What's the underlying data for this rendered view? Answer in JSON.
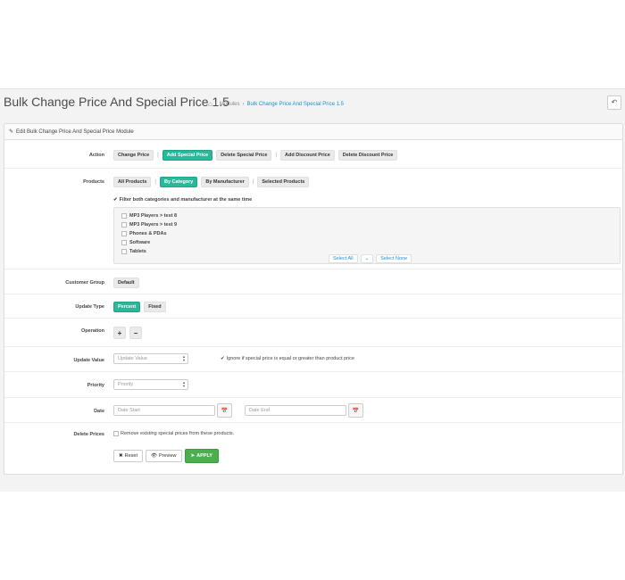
{
  "header": {
    "title": "Bulk Change Price And Special Price 1.5",
    "breadcrumb": [
      "Modules",
      "Bulk Change Price And Special Price 1.5"
    ],
    "home_icon": "home-icon",
    "back_icon": "reply-icon"
  },
  "panel": {
    "heading": "Edit Bulk Change Price And Special Price Module",
    "heading_icon": "pencil-icon"
  },
  "form": {
    "action": {
      "label": "Action",
      "options": [
        "Change Price",
        "Add Special Price",
        "Delete Special Price",
        "Add Discount Price",
        "Delete Discount Price"
      ],
      "selected": "Add Special Price"
    },
    "products": {
      "label": "Products",
      "options": [
        "All Products",
        "By Category",
        "By Manufacturer",
        "Selected Products"
      ],
      "selected": "By Category",
      "filter_label": "Filter both categories and manufacturer at the same time",
      "filter_checked": true,
      "categories": [
        "MP3 Players  >  test 8",
        "MP3 Players  >  test 9",
        "Phones & PDAs",
        "Software",
        "Tablets"
      ],
      "select_all": "Select All",
      "select_none": "Select None"
    },
    "customer_group": {
      "label": "Customer Group",
      "value": "Default"
    },
    "update_type": {
      "label": "Update Type",
      "options": [
        "Percent",
        "Fixed"
      ],
      "selected": "Percent"
    },
    "operation": {
      "label": "Operation",
      "plus": "+",
      "minus": "−"
    },
    "update_value": {
      "label": "Update Value",
      "placeholder": "Update Value",
      "ignore_label": "Ignore if special price is equal or greater than product price",
      "ignore_checked": true
    },
    "priority": {
      "label": "Priority",
      "placeholder": "Priority"
    },
    "date": {
      "label": "Date",
      "start_placeholder": "Date Start",
      "end_placeholder": "Date End",
      "calendar_icon": "calendar-icon"
    },
    "delete_prices": {
      "label": "Delete Prices",
      "text": "Remove existing special prices from these products.",
      "checked": false
    }
  },
  "footer": {
    "reset": "Reset",
    "preview": "Preview",
    "apply": "APPLY"
  },
  "colors": {
    "accent": "#26b99a",
    "link": "#1e91cf",
    "apply": "#4cae4c"
  }
}
